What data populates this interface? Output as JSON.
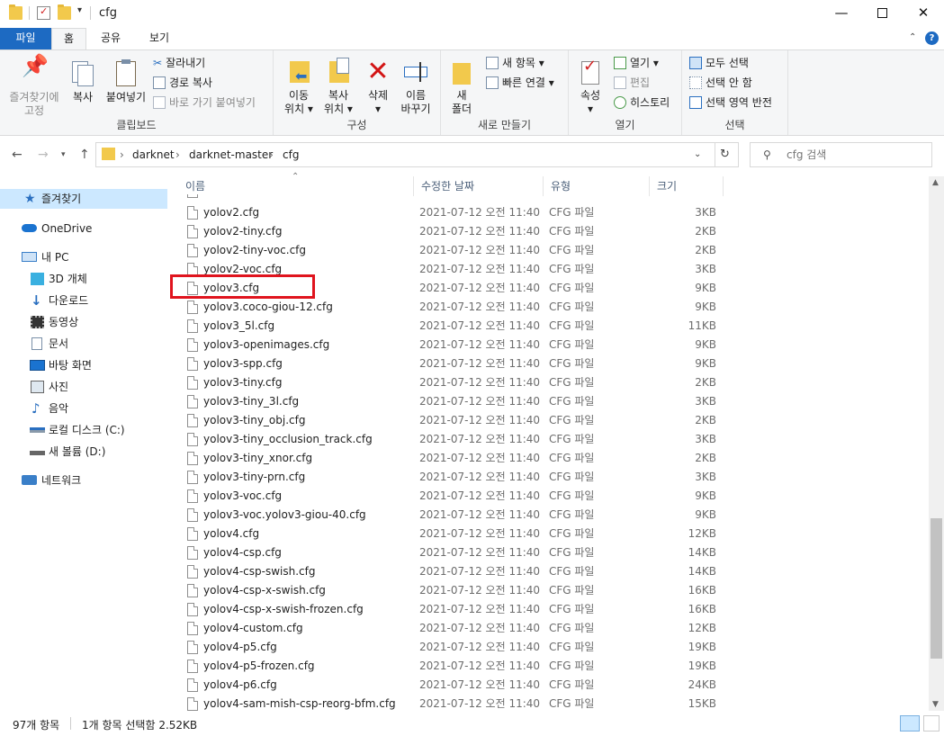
{
  "window": {
    "title": "cfg",
    "minimize": "—",
    "maximize": "☐",
    "close": "✕"
  },
  "ribbon_tabs": {
    "file": "파일",
    "home": "홈",
    "share": "공유",
    "view": "보기"
  },
  "clipboard": {
    "pin": "즐겨찾기에\n고정",
    "pin_l1": "즐겨찾기에",
    "pin_l2": "고정",
    "copy": "복사",
    "paste": "붙여넣기",
    "cut": "잘라내기",
    "copy_path": "경로 복사",
    "paste_shortcut": "바로 가기 붙여넣기",
    "group": "클립보드"
  },
  "organize": {
    "move_l1": "이동",
    "move_l2": "위치 ▾",
    "copy_l1": "복사",
    "copy_l2": "위치 ▾",
    "delete_l1": "삭제",
    "delete_l2": "▾",
    "rename_l1": "이름",
    "rename_l2": "바꾸기",
    "group": "구성"
  },
  "new": {
    "folder_l1": "새",
    "folder_l2": "폴더",
    "new_item": "새 항목 ▾",
    "easy_access": "빠른 연결 ▾",
    "group": "새로 만들기"
  },
  "open": {
    "properties_l1": "속성",
    "properties_l2": "▾",
    "open": "열기 ▾",
    "edit": "편집",
    "history": "히스토리",
    "group": "열기"
  },
  "select": {
    "select_all": "모두 선택",
    "select_none": "선택 안 함",
    "invert": "선택 영역 반전",
    "group": "선택"
  },
  "address": {
    "crumbs": [
      "darknet",
      "darknet-master",
      "cfg"
    ],
    "search_placeholder": "cfg 검색"
  },
  "nav": {
    "quick_access": "즐겨찾기",
    "onedrive": "OneDrive",
    "this_pc": "내 PC",
    "objects3d": "3D 개체",
    "downloads": "다운로드",
    "videos": "동영상",
    "documents": "문서",
    "desktop": "바탕 화면",
    "pictures": "사진",
    "music": "음악",
    "local_disk": "로컬 디스크 (C:)",
    "new_volume": "새 볼륨 (D:)",
    "network": "네트워크"
  },
  "columns": {
    "name": "이름",
    "date": "수정한 날짜",
    "type": "유형",
    "size": "크기"
  },
  "files": [
    {
      "name": "yolov2.cfg",
      "date": "2021-07-12 오전 11:40",
      "type": "CFG 파일",
      "size": "3KB"
    },
    {
      "name": "yolov2-tiny.cfg",
      "date": "2021-07-12 오전 11:40",
      "type": "CFG 파일",
      "size": "2KB"
    },
    {
      "name": "yolov2-tiny-voc.cfg",
      "date": "2021-07-12 오전 11:40",
      "type": "CFG 파일",
      "size": "2KB"
    },
    {
      "name": "yolov2-voc.cfg",
      "date": "2021-07-12 오전 11:40",
      "type": "CFG 파일",
      "size": "3KB"
    },
    {
      "name": "yolov3.cfg",
      "date": "2021-07-12 오전 11:40",
      "type": "CFG 파일",
      "size": "9KB"
    },
    {
      "name": "yolov3.coco-giou-12.cfg",
      "date": "2021-07-12 오전 11:40",
      "type": "CFG 파일",
      "size": "9KB"
    },
    {
      "name": "yolov3_5l.cfg",
      "date": "2021-07-12 오전 11:40",
      "type": "CFG 파일",
      "size": "11KB"
    },
    {
      "name": "yolov3-openimages.cfg",
      "date": "2021-07-12 오전 11:40",
      "type": "CFG 파일",
      "size": "9KB"
    },
    {
      "name": "yolov3-spp.cfg",
      "date": "2021-07-12 오전 11:40",
      "type": "CFG 파일",
      "size": "9KB"
    },
    {
      "name": "yolov3-tiny.cfg",
      "date": "2021-07-12 오전 11:40",
      "type": "CFG 파일",
      "size": "2KB"
    },
    {
      "name": "yolov3-tiny_3l.cfg",
      "date": "2021-07-12 오전 11:40",
      "type": "CFG 파일",
      "size": "3KB"
    },
    {
      "name": "yolov3-tiny_obj.cfg",
      "date": "2021-07-12 오전 11:40",
      "type": "CFG 파일",
      "size": "2KB"
    },
    {
      "name": "yolov3-tiny_occlusion_track.cfg",
      "date": "2021-07-12 오전 11:40",
      "type": "CFG 파일",
      "size": "3KB"
    },
    {
      "name": "yolov3-tiny_xnor.cfg",
      "date": "2021-07-12 오전 11:40",
      "type": "CFG 파일",
      "size": "2KB"
    },
    {
      "name": "yolov3-tiny-prn.cfg",
      "date": "2021-07-12 오전 11:40",
      "type": "CFG 파일",
      "size": "3KB"
    },
    {
      "name": "yolov3-voc.cfg",
      "date": "2021-07-12 오전 11:40",
      "type": "CFG 파일",
      "size": "9KB"
    },
    {
      "name": "yolov3-voc.yolov3-giou-40.cfg",
      "date": "2021-07-12 오전 11:40",
      "type": "CFG 파일",
      "size": "9KB"
    },
    {
      "name": "yolov4.cfg",
      "date": "2021-07-12 오전 11:40",
      "type": "CFG 파일",
      "size": "12KB"
    },
    {
      "name": "yolov4-csp.cfg",
      "date": "2021-07-12 오전 11:40",
      "type": "CFG 파일",
      "size": "14KB"
    },
    {
      "name": "yolov4-csp-swish.cfg",
      "date": "2021-07-12 오전 11:40",
      "type": "CFG 파일",
      "size": "14KB"
    },
    {
      "name": "yolov4-csp-x-swish.cfg",
      "date": "2021-07-12 오전 11:40",
      "type": "CFG 파일",
      "size": "16KB"
    },
    {
      "name": "yolov4-csp-x-swish-frozen.cfg",
      "date": "2021-07-12 오전 11:40",
      "type": "CFG 파일",
      "size": "16KB"
    },
    {
      "name": "yolov4-custom.cfg",
      "date": "2021-07-12 오전 11:40",
      "type": "CFG 파일",
      "size": "12KB"
    },
    {
      "name": "yolov4-p5.cfg",
      "date": "2021-07-12 오전 11:40",
      "type": "CFG 파일",
      "size": "19KB"
    },
    {
      "name": "yolov4-p5-frozen.cfg",
      "date": "2021-07-12 오전 11:40",
      "type": "CFG 파일",
      "size": "19KB"
    },
    {
      "name": "yolov4-p6.cfg",
      "date": "2021-07-12 오전 11:40",
      "type": "CFG 파일",
      "size": "24KB"
    },
    {
      "name": "yolov4-sam-mish-csp-reorg-bfm.cfg",
      "date": "2021-07-12 오전 11:40",
      "type": "CFG 파일",
      "size": "15KB"
    }
  ],
  "status": {
    "item_count": "97개 항목",
    "selection": "1개 항목 선택함 2.52KB"
  },
  "colors": {
    "accent": "#1d6ac2",
    "selected_nav": "#cce8ff",
    "highlight_box": "#e0141e",
    "folder": "#f2c94c"
  }
}
